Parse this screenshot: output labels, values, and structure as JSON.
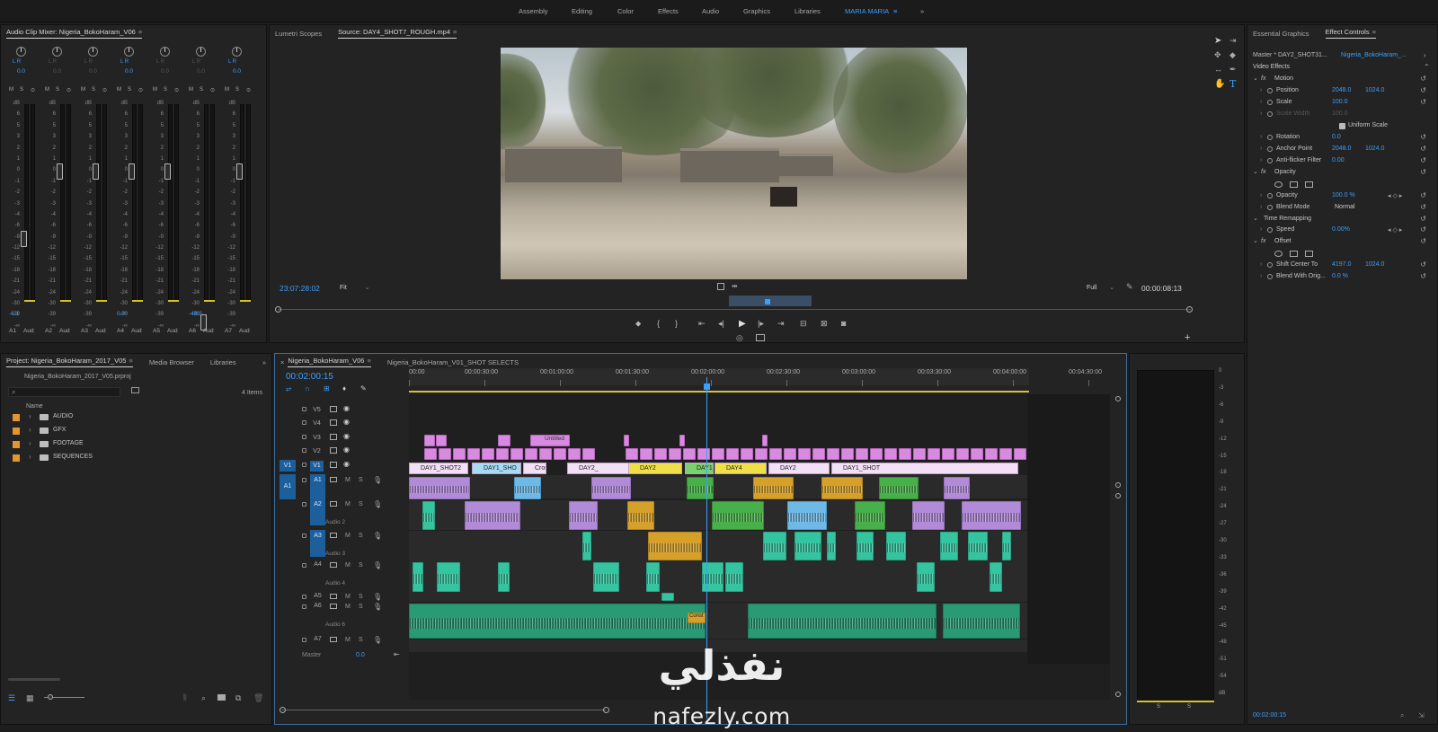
{
  "workspaces": {
    "items": [
      "Assembly",
      "Editing",
      "Color",
      "Effects",
      "Audio",
      "Graphics",
      "Libraries",
      "MARIA MARIA"
    ],
    "active": "MARIA MARIA",
    "more_icon": "double-chevron-right-icon"
  },
  "mixer": {
    "tab_title": "Audio Clip Mixer: Nigeria_BokoHaram_V06",
    "pan_values": [
      "0.0",
      "0.0",
      "0.0",
      "0.0",
      "0.0",
      "0.0",
      "0.0"
    ],
    "lr_label": "L R",
    "msb": [
      "M",
      "S",
      "⊙"
    ],
    "scale": [
      "dB",
      "6",
      "5",
      "3",
      "2",
      "1",
      "0",
      "-1",
      "-2",
      "-3",
      "-4",
      "-6",
      "-9",
      "-12",
      "-15",
      "-18",
      "-21",
      "-24",
      "-30",
      "-39",
      "-∞"
    ],
    "level_values": [
      "-6.1",
      "",
      "",
      "0.0",
      "",
      "-48.3",
      ""
    ],
    "fader_levels_db": [
      -9.0,
      0,
      0,
      0.0,
      0,
      -48.3,
      0
    ],
    "channel_labels": [
      "A1",
      "Aud",
      "A2",
      "Aud",
      "A3",
      "Aud",
      "A4",
      "Aud",
      "A5",
      "Aud",
      "A6",
      "Aud",
      "A7",
      "Aud"
    ]
  },
  "source_monitor": {
    "tabs": [
      "Lumetri Scopes",
      "Source: DAY4_SHOT7_ROUGH.mp4"
    ],
    "active_tab": "Source: DAY4_SHOT7_ROUGH.mp4",
    "timecode_current": "23:07:28:02",
    "fit": "Fit",
    "quality": "Full",
    "duration": "00:00:08:13",
    "transport_icons": [
      "marker-icon",
      "in-point-icon",
      "out-point-icon",
      "go-to-in-icon",
      "step-back-icon",
      "play-icon",
      "step-forward-icon",
      "go-to-out-icon",
      "insert-icon",
      "overwrite-icon",
      "export-frame-icon"
    ],
    "extra_icons": [
      "vr-video-icon",
      "safe-margins-icon"
    ]
  },
  "tools": [
    "selection-tool-icon",
    "track-select-icon",
    "ripple-edit-icon",
    "razor-icon",
    "slip-icon",
    "pen-icon",
    "hand-icon",
    "type-tool-icon"
  ],
  "effect_controls": {
    "tabs": [
      "Essential Graphics",
      "Effect Controls"
    ],
    "active_tab": "Effect Controls",
    "master": "Master * DAY2_SHOT31...",
    "sequence": "Nigeria_BokoHaram_...",
    "section": "Video Effects",
    "rows": [
      {
        "label": "Motion",
        "fx": "fx",
        "indent": 1,
        "value1": "",
        "value2": ""
      },
      {
        "label": "Position",
        "indent": 2,
        "value1": "2048.0",
        "value2": "1024.0"
      },
      {
        "label": "Scale",
        "indent": 2,
        "value1": "100.0",
        "value2": ""
      },
      {
        "label": "Scale Width",
        "indent": 2,
        "value1": "100.0",
        "value2": "",
        "dim": true
      },
      {
        "label": "Uniform Scale",
        "indent": 3,
        "value1": "",
        "value2": "",
        "checkbox": true
      },
      {
        "label": "Rotation",
        "indent": 2,
        "value1": "0.0",
        "value2": ""
      },
      {
        "label": "Anchor Point",
        "indent": 2,
        "value1": "2048.0",
        "value2": "1024.0"
      },
      {
        "label": "Anti-flicker Filter",
        "indent": 2,
        "value1": "0.00",
        "value2": ""
      },
      {
        "label": "Opacity",
        "fx": "fx",
        "indent": 1,
        "value1": "",
        "value2": ""
      },
      {
        "label": "",
        "indent": 2,
        "value1": "",
        "value2": "",
        "masks": true
      },
      {
        "label": "Opacity",
        "indent": 2,
        "value1": "100.0 %",
        "value2": ""
      },
      {
        "label": "Blend Mode",
        "indent": 2,
        "value1": "Normal",
        "value2": ""
      },
      {
        "label": "Time Remapping",
        "indent": 1,
        "value1": "",
        "value2": ""
      },
      {
        "label": "Speed",
        "indent": 2,
        "value1": "0.00%",
        "value2": ""
      },
      {
        "label": "Offset",
        "fx": "fx",
        "indent": 1,
        "value1": "",
        "value2": ""
      },
      {
        "label": "",
        "indent": 2,
        "value1": "",
        "value2": "",
        "masks": true
      },
      {
        "label": "Shift Center To",
        "indent": 2,
        "value1": "4197.0",
        "value2": "1024.0"
      },
      {
        "label": "Blend With Orig...",
        "indent": 2,
        "value1": "0.0 %",
        "value2": ""
      }
    ],
    "timecode": "00:02:00:15"
  },
  "project": {
    "tabs": [
      "Project: Nigeria_BokoHaram_2017_V05",
      "Media Browser",
      "Libraries"
    ],
    "active_tab": "Project: Nigeria_BokoHaram_2017_V05",
    "file": "Nigeria_BokoHaram_2017_V05.prproj",
    "search_placeholder": "",
    "item_count": "4 Items",
    "column_name": "Name",
    "bins": [
      "AUDIO",
      "GFX",
      "FOOTAGE",
      "SEQUENCES"
    ],
    "bin_color": "#e3962f"
  },
  "timeline": {
    "tabs": [
      "Nigeria_BokoHaram_V06",
      "Nigeria_BokoHaram_V01_SHOT SELECTS"
    ],
    "active_tab": "Nigeria_BokoHaram_V06",
    "timecode": "00:02:00:15",
    "ruler": [
      "00:00",
      "00:00:30:00",
      "00:01:00:00",
      "00:01:30:00",
      "00:02:00:00",
      "00:02:30:00",
      "00:03:00:00",
      "00:03:30:00",
      "00:04:00:00",
      "00:04:30:00"
    ],
    "video_tracks": [
      "V5",
      "V4",
      "V3",
      "V2",
      "V1"
    ],
    "source_patch_v": "V1",
    "source_patch_a": "A1",
    "audio_tracks": [
      {
        "id": "A1",
        "name": ""
      },
      {
        "id": "A2",
        "name": "Audio 2"
      },
      {
        "id": "A3",
        "name": "Audio 3"
      },
      {
        "id": "A4",
        "name": "Audio 4"
      },
      {
        "id": "A5",
        "name": ""
      },
      {
        "id": "A6",
        "name": "Audio 6"
      },
      {
        "id": "A7",
        "name": ""
      }
    ],
    "track_buttons": [
      "M",
      "S"
    ],
    "master_label": "Master",
    "master_value": "0.0",
    "v1_clips": [
      "DAY1_SHOT2",
      "DAY1_SHO",
      "Cross",
      "DAY2_",
      "DAY2",
      "DAY1_SH",
      "DAY4",
      "DAY2",
      "DAY1_SHOT"
    ],
    "v3_label": "Untitled",
    "a6_label": "Const"
  },
  "audio_meter": {
    "scale": [
      "0",
      "-3",
      "-6",
      "-9",
      "-12",
      "-15",
      "-18",
      "-21",
      "-24",
      "-27",
      "-30",
      "-33",
      "-36",
      "-39",
      "-42",
      "-45",
      "-48",
      "-51",
      "-54",
      "dB"
    ],
    "solo_labels": [
      "S",
      "S"
    ]
  },
  "watermark": {
    "arabic": "نفذلي",
    "domain": "nafezly.com"
  },
  "colors": {
    "accent": "#3b9fff",
    "video_clip": "#d88ae0",
    "audio_green": "#2a9a74",
    "playhead": "#3b9fff"
  }
}
